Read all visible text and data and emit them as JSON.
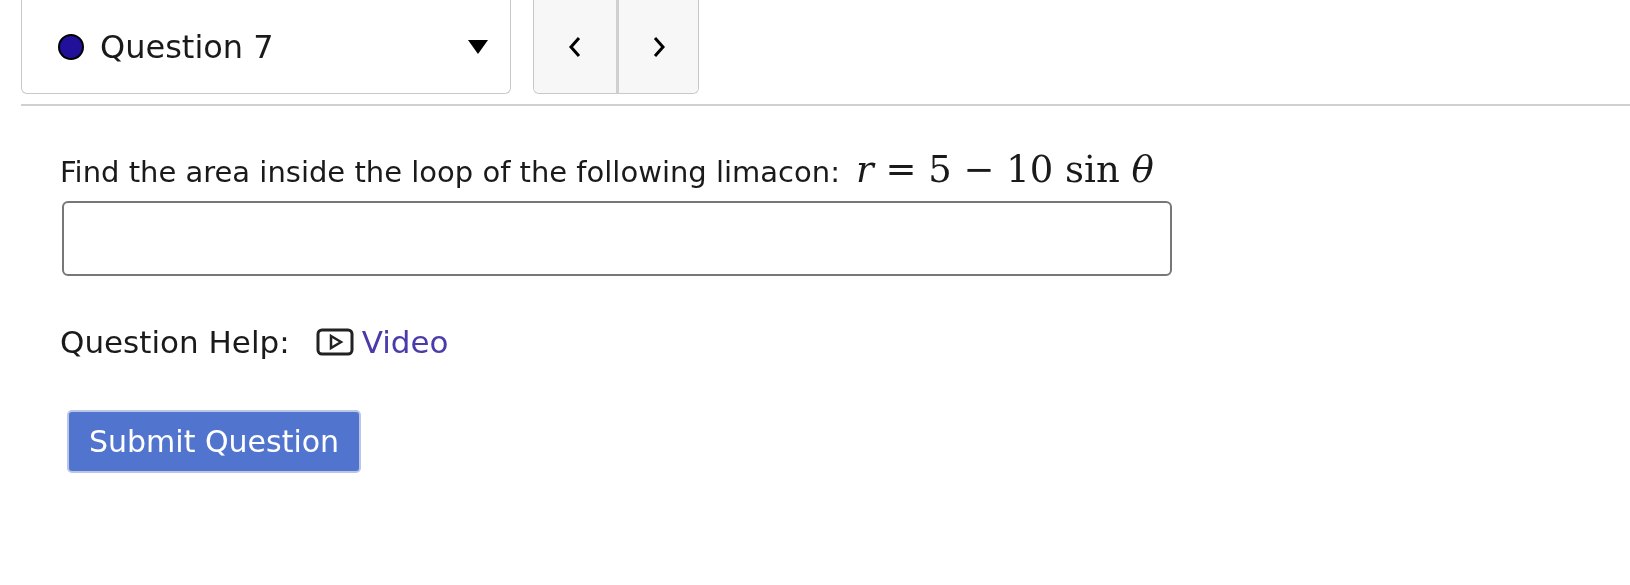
{
  "question_selector": {
    "label": "Question 7"
  },
  "question": {
    "prompt": "Find the area inside the loop of the following limacon:",
    "formula": "*r* = 5 − 10 sin *θ*"
  },
  "help": {
    "label": "Question Help:",
    "links": [
      {
        "kind": "video",
        "label": "Video"
      }
    ]
  },
  "submit": {
    "label": "Submit Question"
  }
}
